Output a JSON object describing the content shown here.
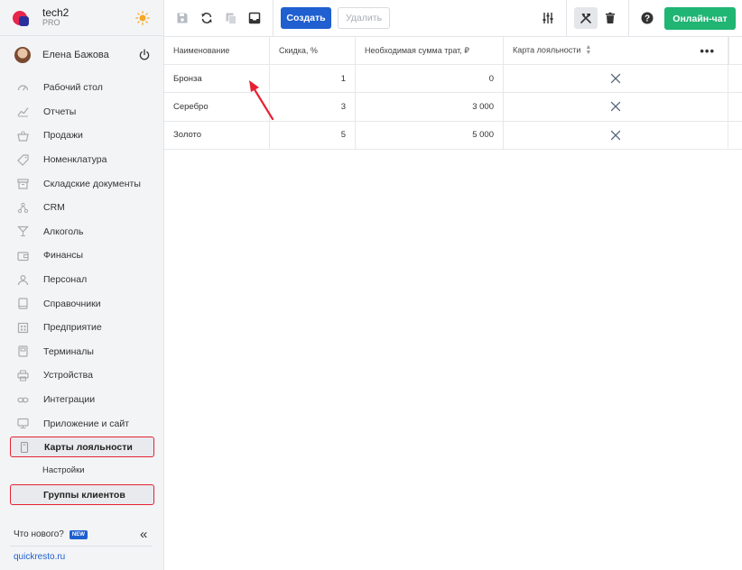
{
  "brand": {
    "name": "tech2",
    "plan": "PRO"
  },
  "user": {
    "name": "Елена Бажова"
  },
  "nav": [
    {
      "label": "Рабочий стол",
      "icon": "dashboard-icon"
    },
    {
      "label": "Отчеты",
      "icon": "reports-icon"
    },
    {
      "label": "Продажи",
      "icon": "sales-basket-icon"
    },
    {
      "label": "Номенклатура",
      "icon": "tag-icon"
    },
    {
      "label": "Складские документы",
      "icon": "warehouse-box-icon"
    },
    {
      "label": "CRM",
      "icon": "crm-icon"
    },
    {
      "label": "Алкоголь",
      "icon": "cocktail-icon"
    },
    {
      "label": "Финансы",
      "icon": "wallet-icon"
    },
    {
      "label": "Персонал",
      "icon": "staff-icon"
    },
    {
      "label": "Справочники",
      "icon": "book-icon"
    },
    {
      "label": "Предприятие",
      "icon": "building-icon"
    },
    {
      "label": "Терминалы",
      "icon": "terminal-icon"
    },
    {
      "label": "Устройства",
      "icon": "printer-icon"
    },
    {
      "label": "Интеграции",
      "icon": "link-icon"
    },
    {
      "label": "Приложение и сайт",
      "icon": "monitor-icon"
    }
  ],
  "nav_active": {
    "label": "Карты лояльности",
    "icon": "loyalty-card-icon"
  },
  "nav_sub": [
    {
      "label": "Настройки"
    },
    {
      "label": "Группы клиентов"
    }
  ],
  "footer": {
    "whats_new": "Что нового?",
    "new_badge": "NEW",
    "site": "quickresto.ru"
  },
  "toolbar": {
    "create": "Создать",
    "delete": "Удалить",
    "chat": "Онлайн-чат"
  },
  "table": {
    "columns": [
      "Наименование",
      "Скидка, %",
      "Необходимая сумма трат, ₽",
      "Карта лояльности"
    ],
    "rows": [
      {
        "name": "Бронза",
        "discount": "1",
        "sum": "0"
      },
      {
        "name": "Серебро",
        "discount": "3",
        "sum": "3 000"
      },
      {
        "name": "Золото",
        "discount": "5",
        "sum": "5 000"
      }
    ]
  },
  "colors": {
    "accent": "#1f5fcf",
    "chat": "#20b573",
    "highlight": "#e52232"
  }
}
